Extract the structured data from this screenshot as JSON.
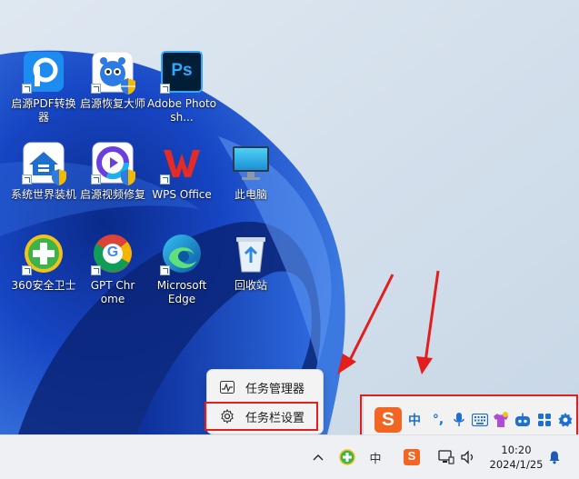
{
  "desktop": {
    "icons": [
      {
        "label": "启源PDF转换器"
      },
      {
        "label": "启源恢复大师"
      },
      {
        "label": "Adobe Photosh..."
      },
      {
        "label": "系统世界装机"
      },
      {
        "label": "启源视频修复"
      },
      {
        "label": "WPS Office"
      },
      {
        "label": "此电脑"
      },
      {
        "label": "360安全卫士"
      },
      {
        "label": "GPT Chrome"
      },
      {
        "label": "Microsoft Edge"
      },
      {
        "label": "回收站"
      }
    ],
    "icon_texts": {
      "photoshop": "Ps",
      "chrome_badge": "G"
    }
  },
  "context_menu": {
    "items": [
      {
        "label": "任务管理器",
        "icon": "task-manager-icon"
      },
      {
        "label": "任务栏设置",
        "icon": "gear-icon"
      }
    ]
  },
  "ime_toolbar": {
    "logo": "S",
    "mode": "中",
    "punct": "°,"
  },
  "taskbar": {
    "ime_mode": "中",
    "sogou": "S",
    "time": "10:20",
    "date": "2024/1/25"
  },
  "colors": {
    "highlight": "#e41d1d",
    "wallpaper_blue": "#1a4bb5",
    "sogou_orange": "#f26522"
  }
}
